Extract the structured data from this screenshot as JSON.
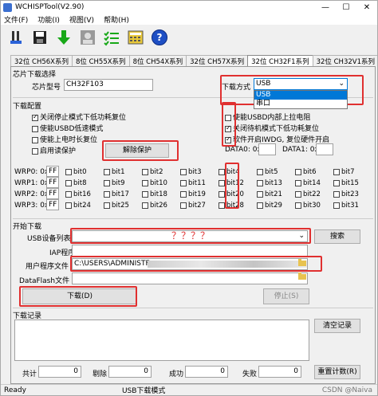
{
  "window": {
    "title": "WCHISPTool(V2.90)",
    "min": "—",
    "max": "☐",
    "close": "✕"
  },
  "menu": [
    "文件(F)",
    "功能(I)",
    "视图(V)",
    "帮助(H)"
  ],
  "tabs": [
    "32位 CH56X系列",
    "8位 CH55X系列",
    "8位 CH54X系列",
    "32位 CH57X系列",
    "32位 CH32F1系列",
    "32位 CH32V1系列"
  ],
  "active_tab": 4,
  "chip": {
    "section": "芯片下载选择",
    "model_label": "芯片型号",
    "model_value": "CH32F103",
    "method_label": "下载方式",
    "method_value": "USB",
    "method_options": [
      "USB",
      "串口"
    ]
  },
  "config": {
    "section": "下载配置",
    "left": [
      {
        "label": "关闭停止模式下低功耗复位",
        "checked": true
      },
      {
        "label": "使能USBD低速模式",
        "checked": false
      },
      {
        "label": "使能上电时长复位",
        "checked": false
      },
      {
        "label": "启用读保护",
        "checked": false
      }
    ],
    "unprotect_button": "解除保护",
    "right": [
      {
        "label": "使能USBD内部上拉电阻",
        "checked": false
      },
      {
        "label": "关闭待机模式下低功耗复位",
        "checked": true
      },
      {
        "label": "软件开启IWDG, 复位硬件开启",
        "checked": true
      }
    ],
    "data0_label": "DATA0: 0x",
    "data0_value": "",
    "data1_label": "DATA1: 0x",
    "data1_value": ""
  },
  "wrp": {
    "rows": [
      {
        "label": "WRP0: 0x",
        "value": "FF",
        "bits": [
          "bit0",
          "bit1",
          "bit2",
          "bit3",
          "bit4",
          "bit5",
          "bit6",
          "bit7"
        ]
      },
      {
        "label": "WRP1: 0x",
        "value": "FF",
        "bits": [
          "bit8",
          "bit9",
          "bit10",
          "bit11",
          "bit12",
          "bit13",
          "bit14",
          "bit15"
        ]
      },
      {
        "label": "WRP2: 0x",
        "value": "FF",
        "bits": [
          "bit16",
          "bit17",
          "bit18",
          "bit19",
          "bit20",
          "bit21",
          "bit22",
          "bit23"
        ]
      },
      {
        "label": "WRP3: 0x",
        "value": "FF",
        "bits": [
          "bit24",
          "bit25",
          "bit26",
          "bit27",
          "bit28",
          "bit29",
          "bit30",
          "bit31"
        ]
      }
    ]
  },
  "download": {
    "section": "开始下载",
    "usb_list_label": "USB设备列表",
    "usb_list_value": "？？？？",
    "search_button": "搜索",
    "iap_label": "IAP程序文件",
    "iap_value": "",
    "user_label": "用户程序文件",
    "user_value": "C:\\USERS\\ADMINISTF",
    "dataflash_label": "DataFlash文件",
    "dataflash_value": "",
    "download_button": "下载(D)",
    "stop_button": "停止(S)"
  },
  "log": {
    "section": "下载记录",
    "clear_button": "清空记录",
    "reset_button": "重置计数(R)",
    "total_label": "共计",
    "total_value": "0",
    "remove_label": "剔除",
    "remove_value": "0",
    "success_label": "成功",
    "success_value": "0",
    "fail_label": "失败",
    "fail_value": "0"
  },
  "status": {
    "ready": "Ready",
    "mode": "USB下载模式",
    "watermark": "CSDN @Naiva"
  },
  "colors": {
    "highlight_red": "#e03030",
    "select_blue": "#0078d7"
  }
}
